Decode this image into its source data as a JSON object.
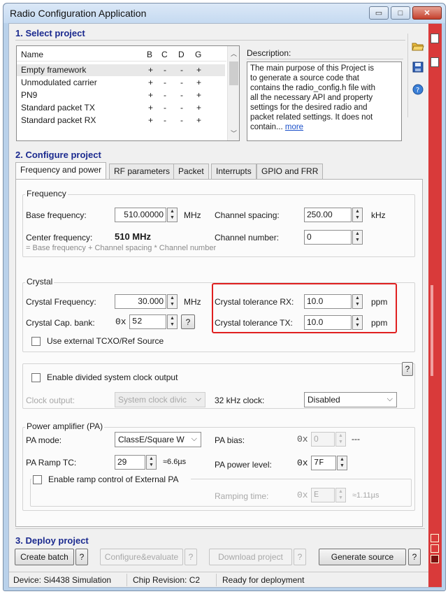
{
  "window": {
    "title": "Radio Configuration Application",
    "buttons": {
      "minimize": "▭",
      "maximize": "□",
      "close": "✕"
    }
  },
  "select_project": {
    "heading": "1. Select project",
    "columns": [
      "Name",
      "B",
      "C",
      "D",
      "G"
    ],
    "rows": [
      {
        "name": "Empty framework",
        "b": "+",
        "c": "-",
        "d": "-",
        "g": "+"
      },
      {
        "name": "Unmodulated carrier",
        "b": "+",
        "c": "-",
        "d": "-",
        "g": "+"
      },
      {
        "name": "PN9",
        "b": "+",
        "c": "-",
        "d": "-",
        "g": "+"
      },
      {
        "name": "Standard packet TX",
        "b": "+",
        "c": "-",
        "d": "-",
        "g": "+"
      },
      {
        "name": "Standard packet RX",
        "b": "+",
        "c": "-",
        "d": "-",
        "g": "+"
      }
    ],
    "description_label": "Description:",
    "description_lines": [
      "The main purpose of this Project is",
      "to generate a source code that",
      "contains the radio_config.h file with",
      "all the necessary API and property",
      "settings for the desired radio and",
      "packet related settings. It does not"
    ],
    "description_last": "contain... ",
    "more_link": "more"
  },
  "configure_project": {
    "heading": "2. Configure project",
    "tabs": [
      "Frequency and power",
      "RF parameters",
      "Packet",
      "Interrupts",
      "GPIO and FRR"
    ],
    "frequency": {
      "group": "Frequency",
      "base_label": "Base frequency:",
      "base_value": "510.00000",
      "base_unit": "MHz",
      "spacing_label": "Channel spacing:",
      "spacing_value": "250.00",
      "spacing_unit": "kHz",
      "center_label": "Center frequency:",
      "center_value": "510 MHz",
      "channel_label": "Channel number:",
      "channel_value": "0",
      "formula": "= Base frequency + Channel spacing * Channel number"
    },
    "crystal": {
      "group": "Crystal",
      "freq_label": "Crystal Frequency:",
      "freq_value": "30.000",
      "freq_unit": "MHz",
      "cap_label": "Crystal Cap. bank:",
      "cap_prefix": "0x",
      "cap_value": "52",
      "help": "?",
      "tol_rx_label": "Crystal tolerance RX:",
      "tol_rx_value": "10.0",
      "tol_tx_label": "Crystal tolerance TX:",
      "tol_tx_value": "10.0",
      "tol_unit": "ppm",
      "tcxo_label": "Use external TCXO/Ref Source"
    },
    "clock": {
      "enable_label": "Enable divided system clock output",
      "help": "?",
      "output_label": "Clock output:",
      "output_value": "System clock divic",
      "khz_label": "32 kHz clock:",
      "khz_value": "Disabled"
    },
    "pa": {
      "group": "Power amplifier (PA)",
      "mode_label": "PA mode:",
      "mode_value": "ClassE/Square W",
      "bias_label": "PA bias:",
      "bias_prefix": "0x",
      "bias_value": "0",
      "bias_dash": "---",
      "ramp_label": "PA Ramp TC:",
      "ramp_value": "29",
      "ramp_note": "≈6.6µs",
      "power_label": "PA power level:",
      "power_prefix": "0x",
      "power_value": "7F",
      "ext_label": "Enable ramp control of External PA",
      "ramping_label": "Ramping time:",
      "ramping_prefix": "0x",
      "ramping_value": "E",
      "ramping_note": "≈1.11µs"
    }
  },
  "deploy": {
    "heading": "3. Deploy project",
    "create_batch": "Create batch",
    "configure_evaluate": "Configure&evaluate",
    "download_project": "Download project",
    "generate_source": "Generate source",
    "help": "?"
  },
  "status": {
    "device": "Device: Si4438  Simulation",
    "chip": "Chip Revision: C2",
    "state": "Ready for deployment"
  },
  "colors": {
    "accent_red": "#d93a3a",
    "heading_blue": "#1b2a8f",
    "highlight": "#e02020"
  },
  "icons": [
    "folder-open-icon",
    "save-disk-icon",
    "help-globe-icon"
  ]
}
